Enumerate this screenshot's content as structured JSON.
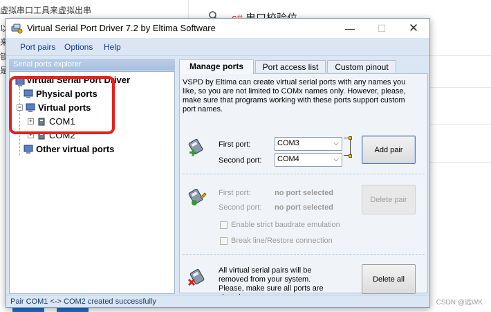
{
  "background": {
    "snippets": [
      "虚拟串口工具来虚拟出串",
      "以右",
      "来",
      "锁",
      "是"
    ],
    "headline_prefix": "c#",
    "headline_rest": " 串口校验位",
    "watermark": "CSDN @远WK"
  },
  "window": {
    "title": "Virtual Serial Port Driver 7.2 by Eltima Software",
    "controls": {
      "minimize": "—",
      "maximize": "☐",
      "close": "✕"
    }
  },
  "menu": [
    "Port pairs",
    "Options",
    "Help"
  ],
  "explorer": {
    "header": "Serial ports explorer",
    "root": "Virtual Serial Port Driver",
    "physical": "Physical ports",
    "virtual": "Virtual ports",
    "ports": [
      "COM1",
      "COM2"
    ],
    "other": "Other virtual ports"
  },
  "tabs": [
    "Manage ports",
    "Port access list",
    "Custom pinout"
  ],
  "manage": {
    "description": "VSPD by Eltima can create virtual serial ports with any names you like, so you are not limited to COMx names only. However, please, make sure that programs working with these ports support custom port names.",
    "add": {
      "first_label": "First port:",
      "first_value": "COM3",
      "second_label": "Second port:",
      "second_value": "COM4",
      "button": "Add pair"
    },
    "delete": {
      "first_label": "First port:",
      "first_value": "no port selected",
      "second_label": "Second port:",
      "second_value": "no port selected",
      "button": "Delete pair",
      "check_strict": "Enable strict baudrate emulation",
      "check_break": "Break line/Restore connection"
    },
    "delete_all": {
      "text": "All virtual serial pairs will be removed from your system. Please, make sure all ports are closed.",
      "button": "Delete all"
    }
  },
  "status": "Pair COM1 <-> COM2 created successfully",
  "colors": {
    "highlight": "#e8201c",
    "accent": "#1a3a8a"
  },
  "icons": [
    "app-icon",
    "pc-icon",
    "port-icon",
    "add-pair-icon",
    "delete-pair-icon",
    "delete-all-icon",
    "search-icon"
  ]
}
